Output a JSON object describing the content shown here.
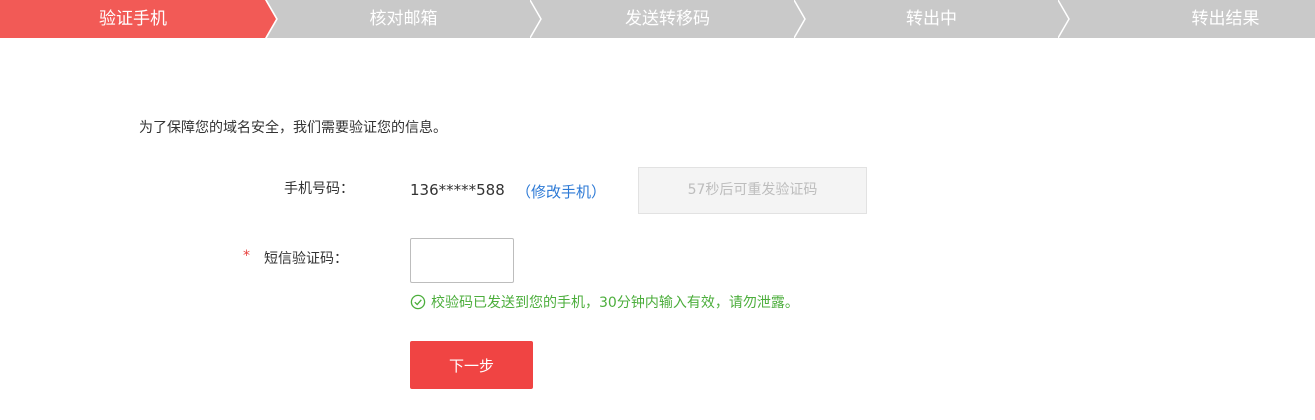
{
  "steps": [
    {
      "label": "验证手机",
      "active": true
    },
    {
      "label": "核对邮箱",
      "active": false
    },
    {
      "label": "发送转移码",
      "active": false
    },
    {
      "label": "转出中",
      "active": false
    },
    {
      "label": "转出结果",
      "active": false
    }
  ],
  "colors": {
    "active_step": "#f25a56",
    "inactive_step": "#c9c9c9",
    "primary": "#f04443",
    "link": "#2d7ad6",
    "success": "#4cae3c"
  },
  "intro": "为了保障您的域名安全，我们需要验证您的信息。",
  "phone": {
    "label": "手机号码：",
    "value": "136*****588",
    "modify_link": "（修改手机）"
  },
  "resend_button": "57秒后可重发验证码",
  "sms": {
    "required_mark": "*",
    "label": "短信验证码：",
    "value": "",
    "placeholder": ""
  },
  "hint": {
    "icon": "check-circle-icon",
    "text": "校验码已发送到您的手机，30分钟内输入有效，请勿泄露。"
  },
  "next_button": "下一步"
}
